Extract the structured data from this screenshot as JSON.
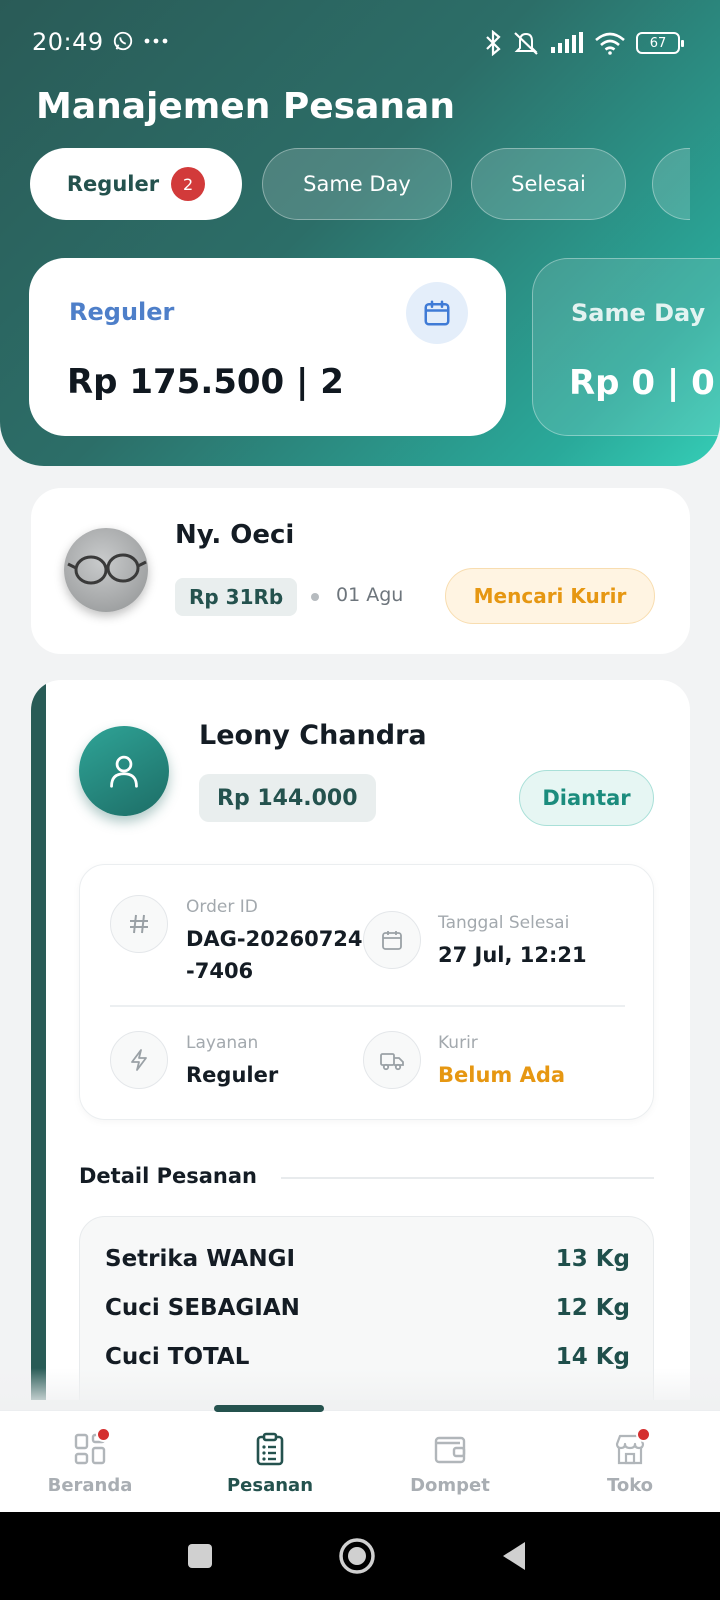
{
  "status_bar": {
    "time": "20:49",
    "battery": "67",
    "icons": [
      "whatsapp-icon",
      "more-dots-icon",
      "bluetooth-icon",
      "mute-icon",
      "signal-icon",
      "wifi-icon",
      "battery-icon"
    ]
  },
  "header": {
    "title": "Manajemen Pesanan"
  },
  "tabs": [
    {
      "label": "Reguler",
      "badge": "2",
      "active": true
    },
    {
      "label": "Same Day",
      "active": false
    },
    {
      "label": "Selesai",
      "active": false
    }
  ],
  "summaries": [
    {
      "label": "Reguler",
      "value": "Rp 175.500 | 2",
      "icon": "calendar-icon"
    },
    {
      "label": "Same Day",
      "value": "Rp 0 | 0"
    }
  ],
  "orders": {
    "compact": {
      "customer": "Ny. Oeci",
      "price": "Rp 31Rb",
      "date": "01 Agu",
      "status": "Mencari Kurir"
    },
    "expanded": {
      "customer": "Leony Chandra",
      "price": "Rp 144.000",
      "status": "Diantar",
      "order_id_label": "Order ID",
      "order_id_line1": "DAG-20260724",
      "order_id_line2": "-7406",
      "finish_label": "Tanggal Selesai",
      "finish_value": "27 Jul, 12:21",
      "service_label": "Layanan",
      "service_value": "Reguler",
      "courier_label": "Kurir",
      "courier_value": "Belum Ada",
      "detail_title": "Detail Pesanan",
      "items": [
        {
          "name": "Setrika WANGI",
          "qty": "13 Kg"
        },
        {
          "name": "Cuci SEBAGIAN",
          "qty": "12 Kg"
        },
        {
          "name": "Cuci TOTAL",
          "qty": "14 Kg"
        }
      ]
    }
  },
  "bottom_nav": [
    {
      "label": "Beranda",
      "icon": "grid-icon",
      "dot": true
    },
    {
      "label": "Pesanan",
      "icon": "clipboard-icon",
      "active": true
    },
    {
      "label": "Dompet",
      "icon": "wallet-icon"
    },
    {
      "label": "Toko",
      "icon": "store-icon",
      "dot": true
    }
  ],
  "colors": {
    "primary": "#24524e",
    "accent_teal": "#2aa99a",
    "badge_red": "#d23a3a",
    "warning_orange": "#e69712",
    "summary_label_blue": "#4e7fc9"
  }
}
